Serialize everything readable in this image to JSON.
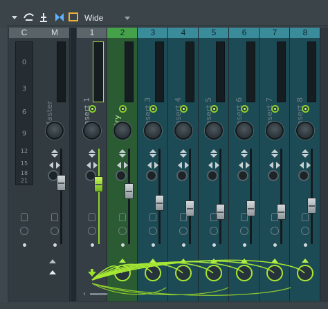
{
  "toolbar": {
    "mode_label": "Wide",
    "icons": [
      "menu-arrow-icon",
      "wiring-icon",
      "link-icon",
      "bowtie-icon",
      "window-icon"
    ]
  },
  "colors": {
    "accent": "#a7e834",
    "teal": "#1d4c57",
    "green": "#2f6e35"
  },
  "strips": [
    {
      "header": "C",
      "name": "",
      "type": "meter"
    },
    {
      "header": "M",
      "name": "Master",
      "type": "master"
    },
    {
      "header": "1",
      "name": "Insert 1",
      "type": "selected"
    },
    {
      "header": "2",
      "name": "dry",
      "type": "green"
    },
    {
      "header": "3",
      "name": "Insert 3",
      "type": "teal"
    },
    {
      "header": "4",
      "name": "Insert 4",
      "type": "teal"
    },
    {
      "header": "5",
      "name": "Insert 5",
      "type": "teal"
    },
    {
      "header": "6",
      "name": "Insert 6",
      "type": "teal"
    },
    {
      "header": "7",
      "name": "Insert 7",
      "type": "teal"
    },
    {
      "header": "8",
      "name": "Insert 8",
      "type": "teal"
    }
  ],
  "scale": [
    "0",
    "3",
    "6",
    "9",
    "12",
    "15",
    "18",
    "21"
  ],
  "fader_levels": {
    "Master": 0.62,
    "Insert 1": 0.6,
    "dry": 0.5,
    "Insert 3": 0.33,
    "Insert 4": 0.25,
    "Insert 5": 0.2,
    "Insert 6": 0.25,
    "Insert 7": 0.2,
    "Insert 8": 0.29
  }
}
